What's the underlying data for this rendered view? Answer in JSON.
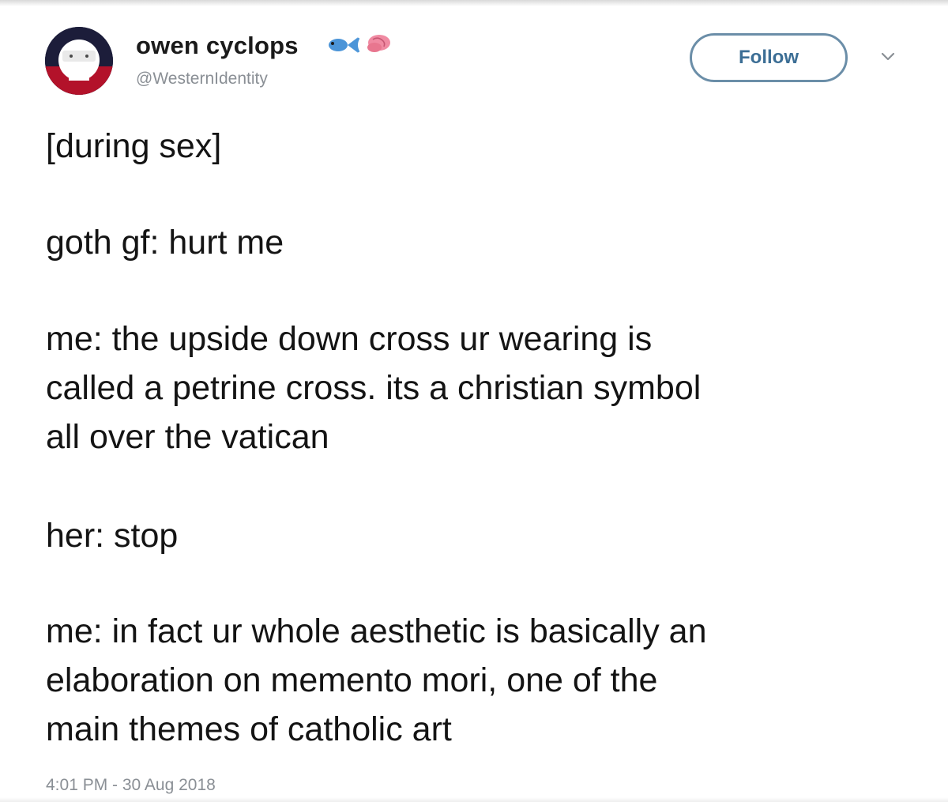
{
  "tweet": {
    "author": {
      "display_name": "owen cyclops",
      "handle": "@WesternIdentity",
      "name_emoji_icons": [
        "fish-icon",
        "brain-icon"
      ]
    },
    "follow_label": "Follow",
    "menu_icon": "chevron-down-icon",
    "lines": [
      "[during sex]",
      "goth gf: hurt me",
      "me: the upside down cross ur wearing is",
      "called a petrine cross. its a christian symbol",
      "all over the vatican",
      "her: stop",
      "me: in fact ur whole aesthetic is basically an",
      "elaboration on memento mori, one of the",
      "main themes of catholic art"
    ],
    "timestamp": "4:01 PM - 30 Aug 2018"
  },
  "colors": {
    "text": "#141414",
    "secondary_text": "#8a8f95",
    "follow_text": "#3c6e95",
    "follow_border": "#6b8ea8"
  }
}
